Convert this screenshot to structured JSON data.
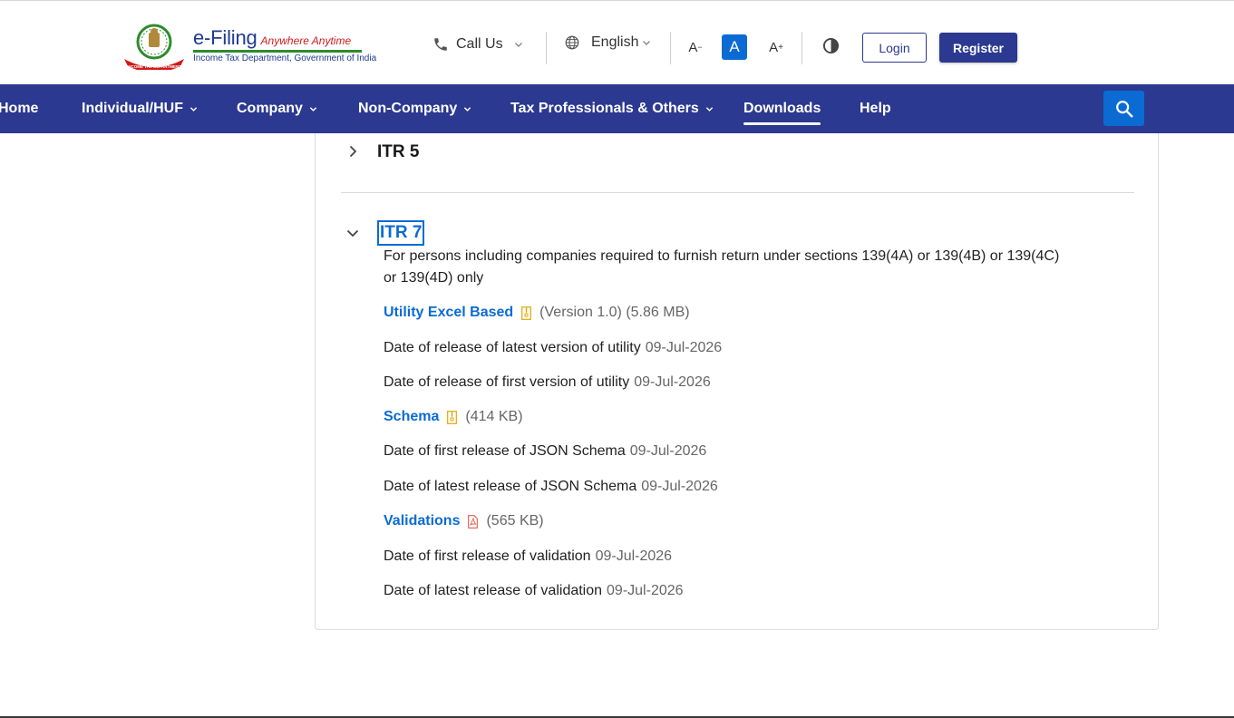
{
  "header": {
    "brand_title": "e-Filing",
    "brand_tagline": "Anywhere Anytime",
    "brand_subtitle": "Income Tax Department, Government of India",
    "emblem_ribbon": "INCOME TAX DEPARTMENT",
    "call_us": "Call Us",
    "language": "English",
    "font_decrease": "A",
    "font_normal": "A",
    "font_increase": "A",
    "login": "Login",
    "register": "Register"
  },
  "nav": {
    "items": [
      {
        "label": "Home",
        "dropdown": false
      },
      {
        "label": "Individual/HUF",
        "dropdown": true
      },
      {
        "label": "Company",
        "dropdown": true
      },
      {
        "label": "Non-Company",
        "dropdown": true
      },
      {
        "label": "Tax Professionals & Others",
        "dropdown": true
      },
      {
        "label": "Downloads",
        "dropdown": false,
        "active": true
      },
      {
        "label": "Help",
        "dropdown": false
      }
    ]
  },
  "accordion": {
    "itr5": {
      "title": "ITR 5",
      "expanded": false
    },
    "itr7": {
      "title": "ITR 7",
      "expanded": true,
      "description": "For persons including companies required to furnish return under sections 139(4A) or 139(4B) or 139(4C) or 139(4D) only",
      "utility": {
        "link": "Utility Excel Based",
        "meta": "(Version 1.0) (5.86 MB)"
      },
      "utility_latest": {
        "label": "Date of release of latest version of utility",
        "date": "09-Jul-2026"
      },
      "utility_first": {
        "label": "Date of release of first version of utility",
        "date": "09-Jul-2026"
      },
      "schema": {
        "link": "Schema",
        "meta": "(414 KB)"
      },
      "schema_first": {
        "label": "Date of first release of JSON Schema",
        "date": "09-Jul-2026"
      },
      "schema_latest": {
        "label": "Date of latest release of JSON Schema",
        "date": "09-Jul-2026"
      },
      "validations": {
        "link": "Validations",
        "meta": "(565 KB)"
      },
      "validation_first": {
        "label": "Date of first release of validation",
        "date": "09-Jul-2026"
      },
      "validation_latest": {
        "label": "Date of latest release of validation",
        "date": "09-Jul-2026"
      }
    }
  },
  "colors": {
    "nav_bg": "#2b3990",
    "link": "#0b6bd3",
    "zip_icon": "#e0a800",
    "pdf_icon": "#e05a4e"
  },
  "icons": {
    "phone": "phone-icon",
    "globe": "globe-icon",
    "contrast": "contrast-icon",
    "search": "search-icon",
    "zip": "zip-file-icon",
    "pdf": "pdf-file-icon"
  }
}
